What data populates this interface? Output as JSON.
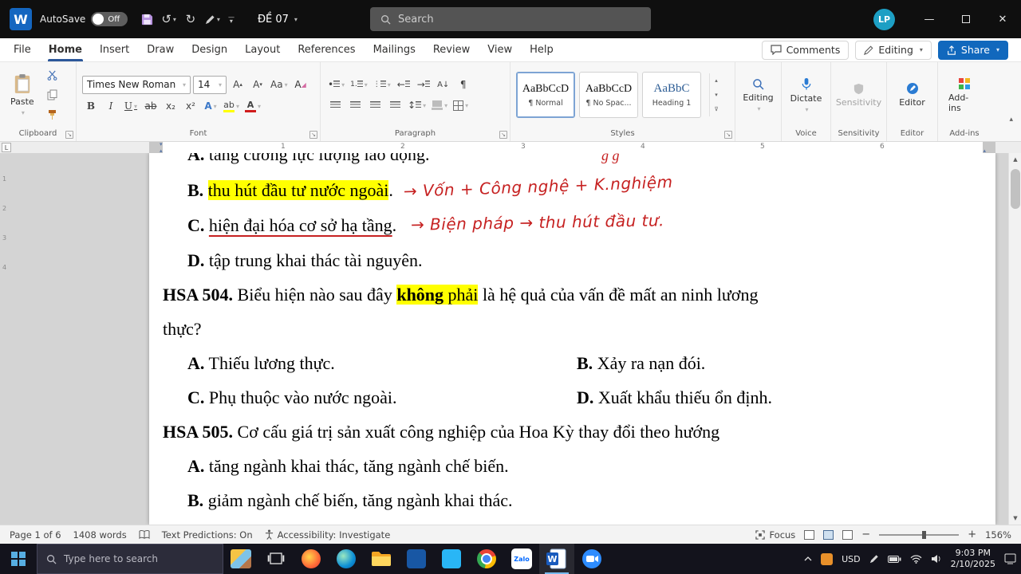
{
  "titlebar": {
    "app_initial": "W",
    "autosave_label": "AutoSave",
    "autosave_state": "Off",
    "doc_title": "ĐỀ 07",
    "search_placeholder": "Search",
    "avatar": "LP"
  },
  "menubar": {
    "items": [
      "File",
      "Home",
      "Insert",
      "Draw",
      "Design",
      "Layout",
      "References",
      "Mailings",
      "Review",
      "View",
      "Help"
    ],
    "comments": "Comments",
    "editing": "Editing",
    "share": "Share"
  },
  "ribbon": {
    "paste": "Paste",
    "font_name": "Times New Roman",
    "font_size": "14",
    "styles": [
      {
        "sample": "AaBbCcD",
        "name": "¶ Normal"
      },
      {
        "sample": "AaBbCcD",
        "name": "¶ No Spac..."
      },
      {
        "sample": "AaBbC",
        "name": "Heading 1"
      }
    ],
    "buttons": {
      "editing": "Editing",
      "dictate": "Dictate",
      "sensitivity": "Sensitivity",
      "editor": "Editor",
      "addins": "Add-ins"
    },
    "group_labels": {
      "clipboard": "Clipboard",
      "font": "Font",
      "paragraph": "Paragraph",
      "styles": "Styles",
      "voice": "Voice",
      "sensitivity": "Sensitivity",
      "editor": "Editor",
      "addins": "Add-ins"
    }
  },
  "ruler": {
    "numbers": [
      "1",
      "2",
      "3",
      "4",
      "5",
      "6"
    ],
    "vnumbers": [
      "1",
      "2",
      "3",
      "4"
    ]
  },
  "document": {
    "cut": {
      "label": "A.",
      "text": "tăng cường lực lượng lao động."
    },
    "scribble": "g g",
    "line_b": {
      "label": "B.",
      "text": "thu hút đầu tư nước ngoài",
      "period": ".",
      "ink": "→ Vốn + Công nghệ + K.nghiệm"
    },
    "line_c": {
      "label": "C.",
      "text": "hiện đại hóa cơ sở hạ tầng",
      "period": ".",
      "ink": "→   Biện pháp  →  thu hút đầu tư."
    },
    "line_d": {
      "label": "D.",
      "text": "tập trung khai thác tài nguyên."
    },
    "q504": {
      "label": "HSA 504.",
      "pre": "Biểu hiện nào sau đây",
      "hl_bold": "không",
      "hl_rest": " phải",
      "post": "là hệ quả của vấn đề mất an ninh lương",
      "wrap": "thực?"
    },
    "q504_a": {
      "label": "A.",
      "text": "Thiếu lương thực."
    },
    "q504_b": {
      "label": "B.",
      "text": "Xảy ra nạn đói."
    },
    "q504_c": {
      "label": "C.",
      "text": "Phụ thuộc vào nước ngoài."
    },
    "q504_d": {
      "label": "D.",
      "text": "Xuất khẩu thiếu ổn định."
    },
    "q505": {
      "label": "HSA 505.",
      "text": "Cơ cấu giá trị sản xuất công nghiệp của Hoa Kỳ thay đổi theo hướng"
    },
    "q505_a": {
      "label": "A.",
      "text": "tăng ngành khai thác, tăng ngành chế biến."
    },
    "q505_b": {
      "label": "B.",
      "text": "giảm ngành chế biến, tăng ngành khai thác."
    }
  },
  "statusbar": {
    "page": "Page 1 of 6",
    "words": "1408 words",
    "predictions": "Text Predictions: On",
    "accessibility": "Accessibility: Investigate",
    "focus": "Focus",
    "zoom": "156%"
  },
  "taskbar": {
    "search_placeholder": "Type here to search",
    "zalo": "Zalo",
    "usd": "USD",
    "time": "9:03 PM",
    "date": "2/10/2025"
  },
  "colors": {
    "highlight": "#ffff00",
    "ink_red": "#c62121",
    "accent": "#2b579a"
  }
}
